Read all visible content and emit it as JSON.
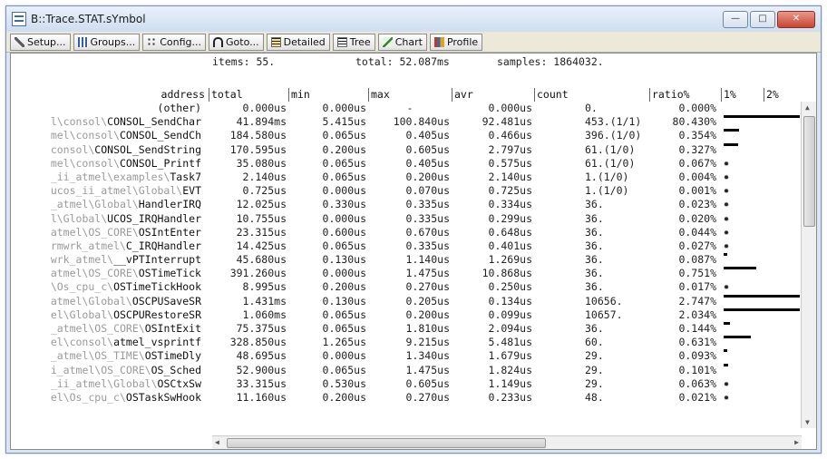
{
  "window": {
    "title": "B::Trace.STAT.sYmbol"
  },
  "toolbar": [
    {
      "label": "Setup...",
      "icon": "wrench-icon"
    },
    {
      "label": "Groups...",
      "icon": "groups-icon"
    },
    {
      "label": "Config...",
      "icon": "config-icon"
    },
    {
      "label": "Goto...",
      "icon": "goto-icon"
    },
    {
      "label": "Detailed",
      "icon": "detailed-icon"
    },
    {
      "label": "Tree",
      "icon": "tree-icon"
    },
    {
      "label": "Chart",
      "icon": "chart-icon"
    },
    {
      "label": "Profile",
      "icon": "profile-icon"
    }
  ],
  "summary": {
    "items": "items: 55.",
    "total": "total: 52.087ms",
    "samples": "samples: 1864032."
  },
  "columns": [
    "address",
    "total",
    "min",
    "max",
    "avr",
    "count",
    "ratio%",
    "1%",
    "2%"
  ],
  "rows": [
    {
      "pre": "",
      "name": "(other)",
      "total": "0.000us",
      "min": "0.000us",
      "max": "-",
      "avr": "0.000us",
      "count": "0.",
      "ratio": "0.000%",
      "bar": 0
    },
    {
      "pre": "l\\consol\\",
      "name": "CONSOL_SendChar",
      "total": "41.894ms",
      "min": "5.415us",
      "max": "100.840us",
      "avr": "92.481us",
      "count": "453.(1/1)",
      "ratio": "80.430%",
      "bar": 80.43
    },
    {
      "pre": "mel\\consol\\",
      "name": "CONSOL_SendCh",
      "total": "184.580us",
      "min": "0.065us",
      "max": "0.405us",
      "avr": "0.466us",
      "count": "396.(1/0)",
      "ratio": "0.354%",
      "bar": 0.354
    },
    {
      "pre": "consol\\",
      "name": "CONSOL_SendString",
      "total": "170.595us",
      "min": "0.200us",
      "max": "0.605us",
      "avr": "2.797us",
      "count": "61.(1/0)",
      "ratio": "0.327%",
      "bar": 0.327
    },
    {
      "pre": "mel\\consol\\",
      "name": "CONSOL_Printf",
      "total": "35.080us",
      "min": "0.065us",
      "max": "0.405us",
      "avr": "0.575us",
      "count": "61.(1/0)",
      "ratio": "0.067%",
      "bar": 0.067
    },
    {
      "pre": "_ii_atmel\\examples\\",
      "name": "Task7",
      "total": "2.140us",
      "min": "0.065us",
      "max": "0.200us",
      "avr": "2.140us",
      "count": "1.(1/0)",
      "ratio": "0.004%",
      "bar": 0.004
    },
    {
      "pre": "ucos_ii_atmel\\Global\\",
      "name": "EVT",
      "total": "0.725us",
      "min": "0.000us",
      "max": "0.070us",
      "avr": "0.725us",
      "count": "1.(1/0)",
      "ratio": "0.001%",
      "bar": 0.001
    },
    {
      "pre": "_atmel\\Global\\",
      "name": "HandlerIRQ",
      "total": "12.025us",
      "min": "0.330us",
      "max": "0.335us",
      "avr": "0.334us",
      "count": "36.",
      "ratio": "0.023%",
      "bar": 0.023
    },
    {
      "pre": "l\\Global\\",
      "name": "UCOS_IRQHandler",
      "total": "10.755us",
      "min": "0.000us",
      "max": "0.335us",
      "avr": "0.299us",
      "count": "36.",
      "ratio": "0.020%",
      "bar": 0.02
    },
    {
      "pre": "atmel\\OS_CORE\\",
      "name": "OSIntEnter",
      "total": "23.315us",
      "min": "0.600us",
      "max": "0.670us",
      "avr": "0.648us",
      "count": "36.",
      "ratio": "0.044%",
      "bar": 0.044
    },
    {
      "pre": "rmwrk_atmel\\",
      "name": "C_IRQHandler",
      "total": "14.425us",
      "min": "0.065us",
      "max": "0.335us",
      "avr": "0.401us",
      "count": "36.",
      "ratio": "0.027%",
      "bar": 0.027
    },
    {
      "pre": "wrk_atmel\\",
      "name": "__vPTInterrupt",
      "total": "45.680us",
      "min": "0.130us",
      "max": "1.140us",
      "avr": "1.269us",
      "count": "36.",
      "ratio": "0.087%",
      "bar": 0.087
    },
    {
      "pre": "atmel\\OS_CORE\\",
      "name": "OSTimeTick",
      "total": "391.260us",
      "min": "0.000us",
      "max": "1.475us",
      "avr": "10.868us",
      "count": "36.",
      "ratio": "0.751%",
      "bar": 0.751
    },
    {
      "pre": "\\Os_cpu_c\\",
      "name": "OSTimeTickHook",
      "total": "8.995us",
      "min": "0.200us",
      "max": "0.270us",
      "avr": "0.250us",
      "count": "36.",
      "ratio": "0.017%",
      "bar": 0.017
    },
    {
      "pre": "atmel\\Global\\",
      "name": "OSCPUSaveSR",
      "total": "1.431ms",
      "min": "0.130us",
      "max": "0.205us",
      "avr": "0.134us",
      "count": "10656.",
      "ratio": "2.747%",
      "bar": 2.747
    },
    {
      "pre": "el\\Global\\",
      "name": "OSCPURestoreSR",
      "total": "1.060ms",
      "min": "0.065us",
      "max": "0.200us",
      "avr": "0.099us",
      "count": "10657.",
      "ratio": "2.034%",
      "bar": 2.034
    },
    {
      "pre": "_atmel\\OS_CORE\\",
      "name": "OSIntExit",
      "total": "75.375us",
      "min": "0.065us",
      "max": "1.810us",
      "avr": "2.094us",
      "count": "36.",
      "ratio": "0.144%",
      "bar": 0.144
    },
    {
      "pre": "el\\consol\\",
      "name": "atmel_vsprintf",
      "total": "328.850us",
      "min": "1.265us",
      "max": "9.215us",
      "avr": "5.481us",
      "count": "60.",
      "ratio": "0.631%",
      "bar": 0.631
    },
    {
      "pre": "_atmel\\OS_TIME\\",
      "name": "OSTimeDly",
      "total": "48.695us",
      "min": "0.000us",
      "max": "1.340us",
      "avr": "1.679us",
      "count": "29.",
      "ratio": "0.093%",
      "bar": 0.093
    },
    {
      "pre": "i_atmel\\OS_CORE\\",
      "name": "OS_Sched",
      "total": "52.900us",
      "min": "0.065us",
      "max": "1.475us",
      "avr": "1.824us",
      "count": "29.",
      "ratio": "0.101%",
      "bar": 0.101
    },
    {
      "pre": "_ii_atmel\\Global\\",
      "name": "OSCtxSw",
      "total": "33.315us",
      "min": "0.530us",
      "max": "0.605us",
      "avr": "1.149us",
      "count": "29.",
      "ratio": "0.063%",
      "bar": 0.063
    },
    {
      "pre": "el\\Os_cpu_c\\",
      "name": "OSTaskSwHook",
      "total": "11.160us",
      "min": "0.200us",
      "max": "0.270us",
      "avr": "0.233us",
      "count": "48.",
      "ratio": "0.021%",
      "bar": 0.021
    }
  ]
}
